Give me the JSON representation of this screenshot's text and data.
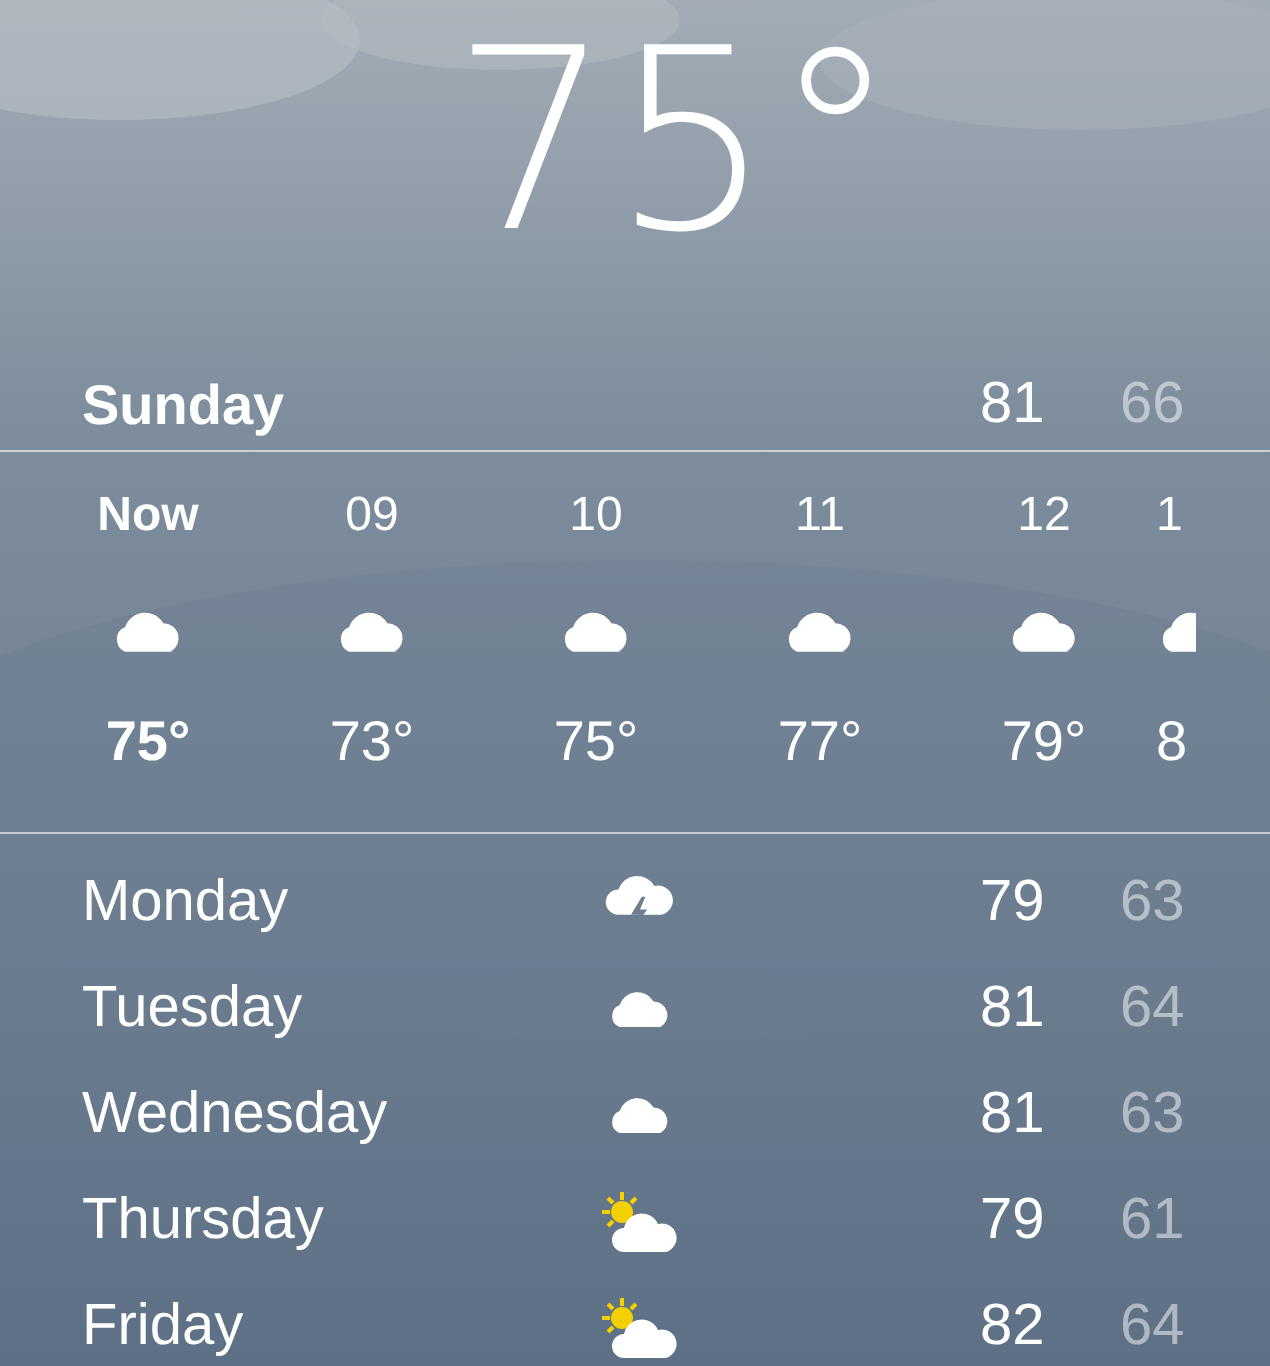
{
  "current": {
    "temperature": "75°"
  },
  "today": {
    "day": "Sunday",
    "high": "81",
    "low": "66"
  },
  "hourly": [
    {
      "time": "Now",
      "kind": "cloud",
      "temp": "75°",
      "current": true
    },
    {
      "time": "09",
      "kind": "cloud",
      "temp": "73°",
      "current": false
    },
    {
      "time": "10",
      "kind": "cloud",
      "temp": "75°",
      "current": false
    },
    {
      "time": "11",
      "kind": "cloud",
      "temp": "77°",
      "current": false
    },
    {
      "time": "12",
      "kind": "cloud",
      "temp": "79°",
      "current": false
    },
    {
      "time": "1",
      "kind": "cloud",
      "temp": "8",
      "current": false
    }
  ],
  "daily": [
    {
      "day": "Monday",
      "kind": "thunder",
      "high": "79",
      "low": "63"
    },
    {
      "day": "Tuesday",
      "kind": "cloud",
      "high": "81",
      "low": "64"
    },
    {
      "day": "Wednesday",
      "kind": "cloud",
      "high": "81",
      "low": "63"
    },
    {
      "day": "Thursday",
      "kind": "partly",
      "high": "79",
      "low": "61"
    },
    {
      "day": "Friday",
      "kind": "partly",
      "high": "82",
      "low": "64"
    }
  ]
}
